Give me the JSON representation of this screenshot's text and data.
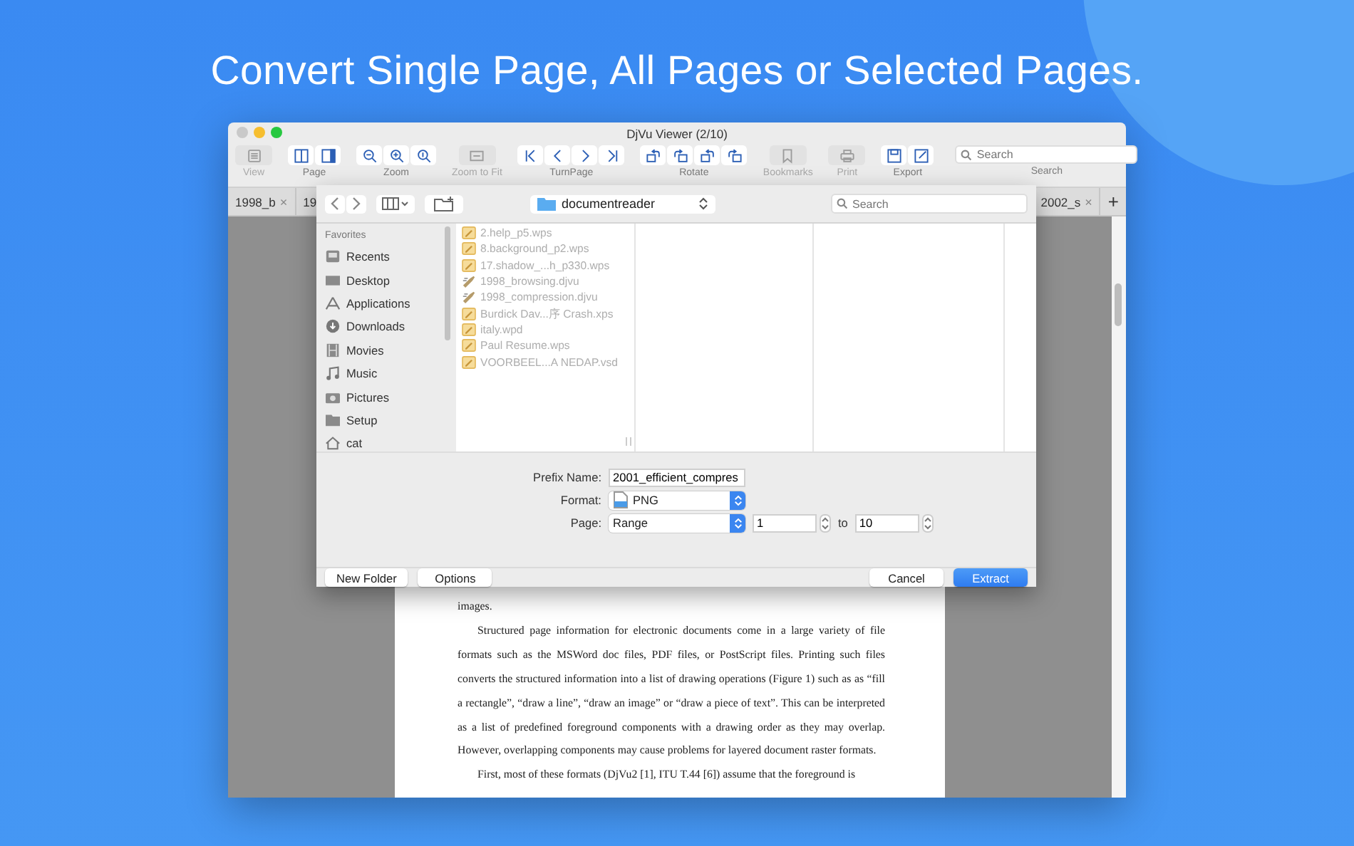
{
  "headline": "Convert Single Page, All Pages or Selected Pages.",
  "window": {
    "title": "DjVu Viewer (2/10)",
    "toolbar": [
      {
        "label": "View",
        "disabled": true,
        "buttons": [
          {
            "kind": "list"
          }
        ]
      },
      {
        "label": "Page",
        "disabled": false,
        "buttons": [
          {
            "kind": "columns"
          },
          {
            "kind": "sidebar"
          }
        ]
      },
      {
        "label": "Zoom",
        "disabled": false,
        "buttons": [
          {
            "kind": "zoom-out"
          },
          {
            "kind": "zoom-in"
          },
          {
            "kind": "zoom-actual"
          }
        ]
      },
      {
        "label": "Zoom to Fit",
        "disabled": true,
        "buttons": [
          {
            "kind": "fit"
          }
        ]
      },
      {
        "label": "TurnPage",
        "disabled": false,
        "buttons": [
          {
            "kind": "first"
          },
          {
            "kind": "prev"
          },
          {
            "kind": "next"
          },
          {
            "kind": "last"
          }
        ]
      },
      {
        "label": "Rotate",
        "disabled": false,
        "buttons": [
          {
            "kind": "rotate-left"
          },
          {
            "kind": "rotate-right"
          },
          {
            "kind": "rotate-left"
          },
          {
            "kind": "rotate-right"
          }
        ]
      },
      {
        "label": "Bookmarks",
        "disabled": true,
        "buttons": [
          {
            "kind": "bookmark"
          }
        ]
      },
      {
        "label": "Print",
        "disabled": true,
        "buttons": [
          {
            "kind": "print"
          }
        ]
      },
      {
        "label": "Export",
        "disabled": false,
        "buttons": [
          {
            "kind": "save"
          },
          {
            "kind": "edit"
          }
        ]
      }
    ],
    "search": {
      "placeholder": "Search",
      "label": "Search"
    },
    "tabs": [
      {
        "label": "1998_b",
        "close": "×"
      },
      {
        "label": "19"
      },
      {
        "label": "2002_s",
        "close": "×"
      }
    ],
    "new_tab": "+",
    "paragraphs": [
      {
        "indent": false,
        "text": "images."
      },
      {
        "indent": true,
        "text": "Structured page information for electronic documents come in a large variety of file formats such as the MSWord doc files, PDF files, or PostScript files. Printing such files converts the structured information into a list of drawing operations (Figure 1) such as as “fill a rectangle”, “draw a line”, “draw an image” or “draw a piece of text”. This can be interpreted as a list of predefined foreground components with a drawing order as they may overlap. However, overlapping components may cause problems for layered document raster formats."
      },
      {
        "indent": true,
        "text": "First, most of these formats (DjVu2 [1], ITU T.44 [6]) assume that the foreground is"
      }
    ]
  },
  "dialog": {
    "location": "documentreader",
    "search_placeholder": "Search",
    "sidebar_heading": "Favorites",
    "sidebar": [
      {
        "label": "Recents",
        "kind": "recents"
      },
      {
        "label": "Desktop",
        "kind": "desktop"
      },
      {
        "label": "Applications",
        "kind": "applications"
      },
      {
        "label": "Downloads",
        "kind": "downloads"
      },
      {
        "label": "Movies",
        "kind": "movies"
      },
      {
        "label": "Music",
        "kind": "music"
      },
      {
        "label": "Pictures",
        "kind": "pictures"
      },
      {
        "label": "Setup",
        "kind": "folder"
      },
      {
        "label": "cat",
        "kind": "home"
      }
    ],
    "files": [
      {
        "name": "2.help_p5.wps",
        "kind": "doc",
        "disabled": true
      },
      {
        "name": "8.background_p2.wps",
        "kind": "doc",
        "disabled": true
      },
      {
        "name": "17.shadow_...h_p330.wps",
        "kind": "doc",
        "disabled": true
      },
      {
        "name": "1998_browsing.djvu",
        "kind": "djvu",
        "disabled": true
      },
      {
        "name": "1998_compression.djvu",
        "kind": "djvu",
        "disabled": true
      },
      {
        "name": "Burdick Dav...序 Crash.xps",
        "kind": "doc",
        "disabled": true
      },
      {
        "name": "italy.wpd",
        "kind": "doc",
        "disabled": true
      },
      {
        "name": "Paul Resume.wps",
        "kind": "doc",
        "disabled": true
      },
      {
        "name": "VOORBEEL...A NEDAP.vsd",
        "kind": "doc",
        "disabled": true
      }
    ],
    "fields": [
      {
        "kind": "text",
        "label": "Prefix Name:",
        "value": "2001_efficient_compres"
      },
      {
        "kind": "image-popup",
        "label": "Format:",
        "value": "PNG"
      },
      {
        "kind": "range",
        "label": "Page:",
        "value": "Range",
        "from": "1",
        "separator": "to",
        "to": "10"
      }
    ],
    "left_buttons": [
      {
        "label": "New Folder",
        "default": false
      },
      {
        "label": "Options",
        "default": false
      }
    ],
    "right_buttons": [
      {
        "label": "Cancel",
        "default": false
      },
      {
        "label": "Extract",
        "default": true
      }
    ]
  }
}
